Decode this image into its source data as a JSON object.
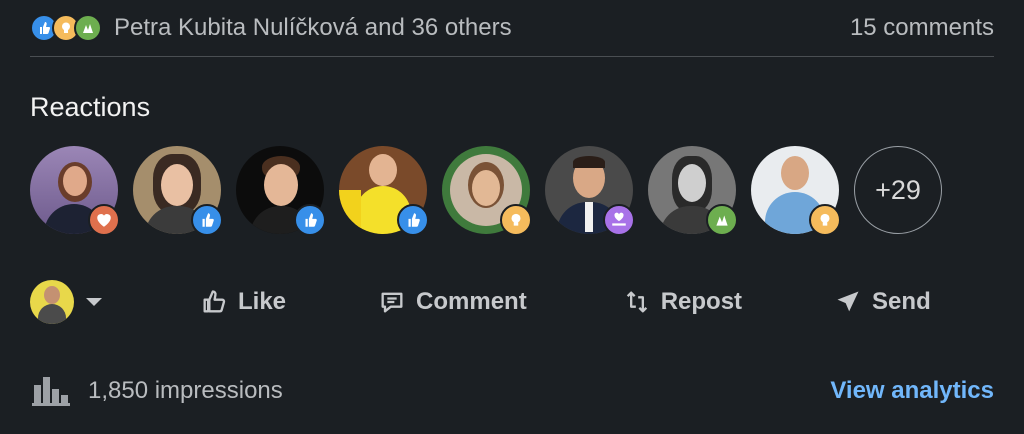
{
  "social": {
    "summary": "Petra Kubita Nulíčková and 36 others",
    "comments": "15 comments"
  },
  "reactions": {
    "title": "Reactions",
    "more": "+29"
  },
  "actions": {
    "like": "Like",
    "comment": "Comment",
    "repost": "Repost",
    "send": "Send"
  },
  "footer": {
    "impressions": "1,850 impressions",
    "analytics": "View analytics"
  },
  "colors": {
    "background": "#1b1f23",
    "link": "#71b7fb",
    "like": "#378fe9",
    "love": "#df704d",
    "insightful": "#f5bb5c",
    "celebrate": "#6dae4f",
    "support": "#a872e8"
  }
}
